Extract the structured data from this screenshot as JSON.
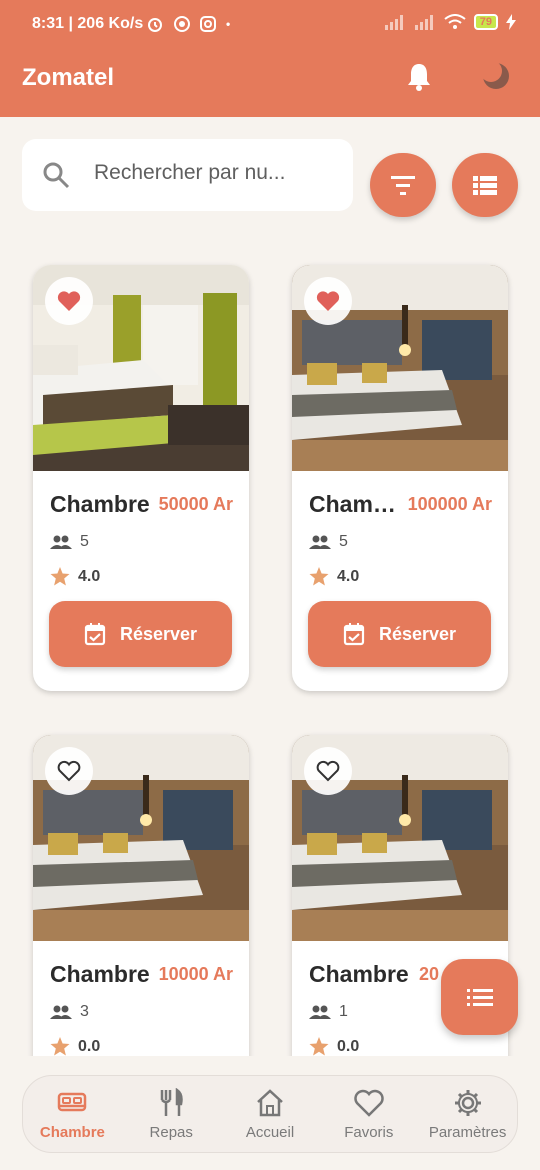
{
  "status_bar": {
    "time": "8:31",
    "speed": "206 Ko/s",
    "battery": "79"
  },
  "header": {
    "title": "Zomatel",
    "bell_icon": "bell-icon",
    "theme_icon": "moon-icon"
  },
  "search": {
    "placeholder": "Rechercher par nu..."
  },
  "toolbar": {
    "filter_icon": "filter-icon",
    "view_icon": "list-view-icon"
  },
  "rooms": [
    {
      "name": "Chambre",
      "price": "50000 Ar",
      "capacity": "5",
      "rating": "4.0",
      "favorite": true,
      "reserve_label": "Réserver"
    },
    {
      "name": "Chambre",
      "price": "100000 Ar",
      "capacity": "5",
      "rating": "4.0",
      "favorite": true,
      "reserve_label": "Réserver"
    },
    {
      "name": "Chambre",
      "price": "10000 Ar",
      "capacity": "3",
      "rating": "0.0",
      "favorite": false
    },
    {
      "name": "Chambre",
      "price": "20",
      "capacity": "1",
      "rating": "0.0",
      "favorite": false
    }
  ],
  "nav": {
    "items": [
      {
        "label": "Chambre",
        "icon": "bed-icon",
        "active": true
      },
      {
        "label": "Repas",
        "icon": "utensils-icon",
        "active": false
      },
      {
        "label": "Accueil",
        "icon": "home-icon",
        "active": false
      },
      {
        "label": "Favoris",
        "icon": "heart-icon",
        "active": false
      },
      {
        "label": "Paramètres",
        "icon": "gear-icon",
        "active": false
      }
    ]
  },
  "colors": {
    "accent": "#e57a5b",
    "background": "#f7f3ee"
  }
}
